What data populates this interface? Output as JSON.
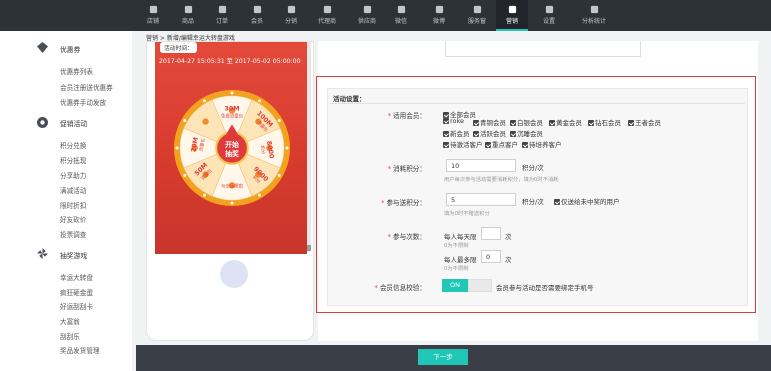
{
  "nav": {
    "items": [
      {
        "label": "店铺",
        "icon": "store-icon"
      },
      {
        "label": "商品",
        "icon": "bag-icon"
      },
      {
        "label": "订单",
        "icon": "order-icon"
      },
      {
        "label": "会员",
        "icon": "member-icon"
      },
      {
        "label": "分销",
        "icon": "pie-icon"
      },
      {
        "label": "代理商",
        "icon": "agent-icon"
      },
      {
        "label": "供应商",
        "icon": "supplier-icon"
      },
      {
        "label": "微信",
        "icon": "wechat-icon"
      },
      {
        "label": "微博",
        "icon": "weibo-icon"
      },
      {
        "label": "服务窗",
        "icon": "service-window-icon"
      },
      {
        "label": "营销",
        "icon": "marketing-icon"
      },
      {
        "label": "设置",
        "icon": "gear-icon"
      },
      {
        "label": "分析统计",
        "icon": "chart-icon"
      }
    ],
    "active": "营销"
  },
  "sidebar": {
    "groups": [
      {
        "title": "优惠券",
        "icon": "diamond-icon",
        "items": [
          "优惠券列表",
          "会员注册送优惠券",
          "优惠券手动发放"
        ]
      },
      {
        "title": "促销活动",
        "icon": "badge-icon",
        "items": [
          "积分兑换",
          "积分抵现",
          "分享助力",
          "满减活动",
          "限时折扣",
          "好友砍价",
          "投票调查"
        ]
      },
      {
        "title": "抽奖游戏",
        "icon": "pinwheel-icon",
        "items": [
          "幸运大转盘",
          "疯狂砸金蛋",
          "好运刮刮卡",
          "大富翁",
          "刮刮乐",
          "奖品发货管理"
        ]
      }
    ]
  },
  "breadcrumb": "营销 > 新增/编辑幸运大转盘游戏",
  "preview": {
    "time_tag": "活动时间：",
    "time_range": "2017-04-27 15:05:31 至 2017-05-02 05:00:00",
    "wheel_center": [
      "开始",
      "抽奖"
    ],
    "wheel_prizes": [
      "30M",
      "免费流量包",
      "100M",
      "流量包",
      "20M",
      "流量包",
      "8000",
      "积分",
      "50M",
      "流量包",
      "与幸运擦肩",
      "9000",
      "积分"
    ]
  },
  "settings": {
    "title": "活动设置：",
    "member_label": "适用会员：",
    "member_options": [
      [
        "全部会员"
      ],
      [
        "roke",
        "青铜会员",
        "白银会员",
        "黄金会员",
        "钻石会员",
        "王者会员"
      ],
      [
        "新会员",
        "活跃会员",
        "沉睡会员"
      ],
      [
        "待激活客户",
        "重点客户",
        "待培养客户"
      ]
    ],
    "cost_label": "消耗积分：",
    "cost_value": "10",
    "cost_unit": "积分/次",
    "cost_hint": "用户每次参与活动需要消耗积分，填为0时不消耗",
    "reward_label": "参与送积分：",
    "reward_value": "5",
    "reward_unit": "积分/次",
    "reward_extra": "仅送给未中奖的用户",
    "reward_hint": "填为0时不赠送积分",
    "times_label": "参与次数：",
    "daily_prefix": "每人每天限",
    "daily_value": "",
    "daily_unit": "次",
    "daily_hint": "0为不限制",
    "max_prefix": "每人最多限",
    "max_value": "0",
    "max_unit": "次",
    "max_hint": "0为不限制",
    "verify_label": "会员信息校验：",
    "verify_toggle": "ON",
    "verify_desc": "会员参与活动是否需要绑定手机号"
  },
  "footer": {
    "next_label": "下一步"
  },
  "colors": {
    "accent": "#20c7b6",
    "highlight_border": "#e03b3b",
    "nav_bg": "#2d3138"
  }
}
